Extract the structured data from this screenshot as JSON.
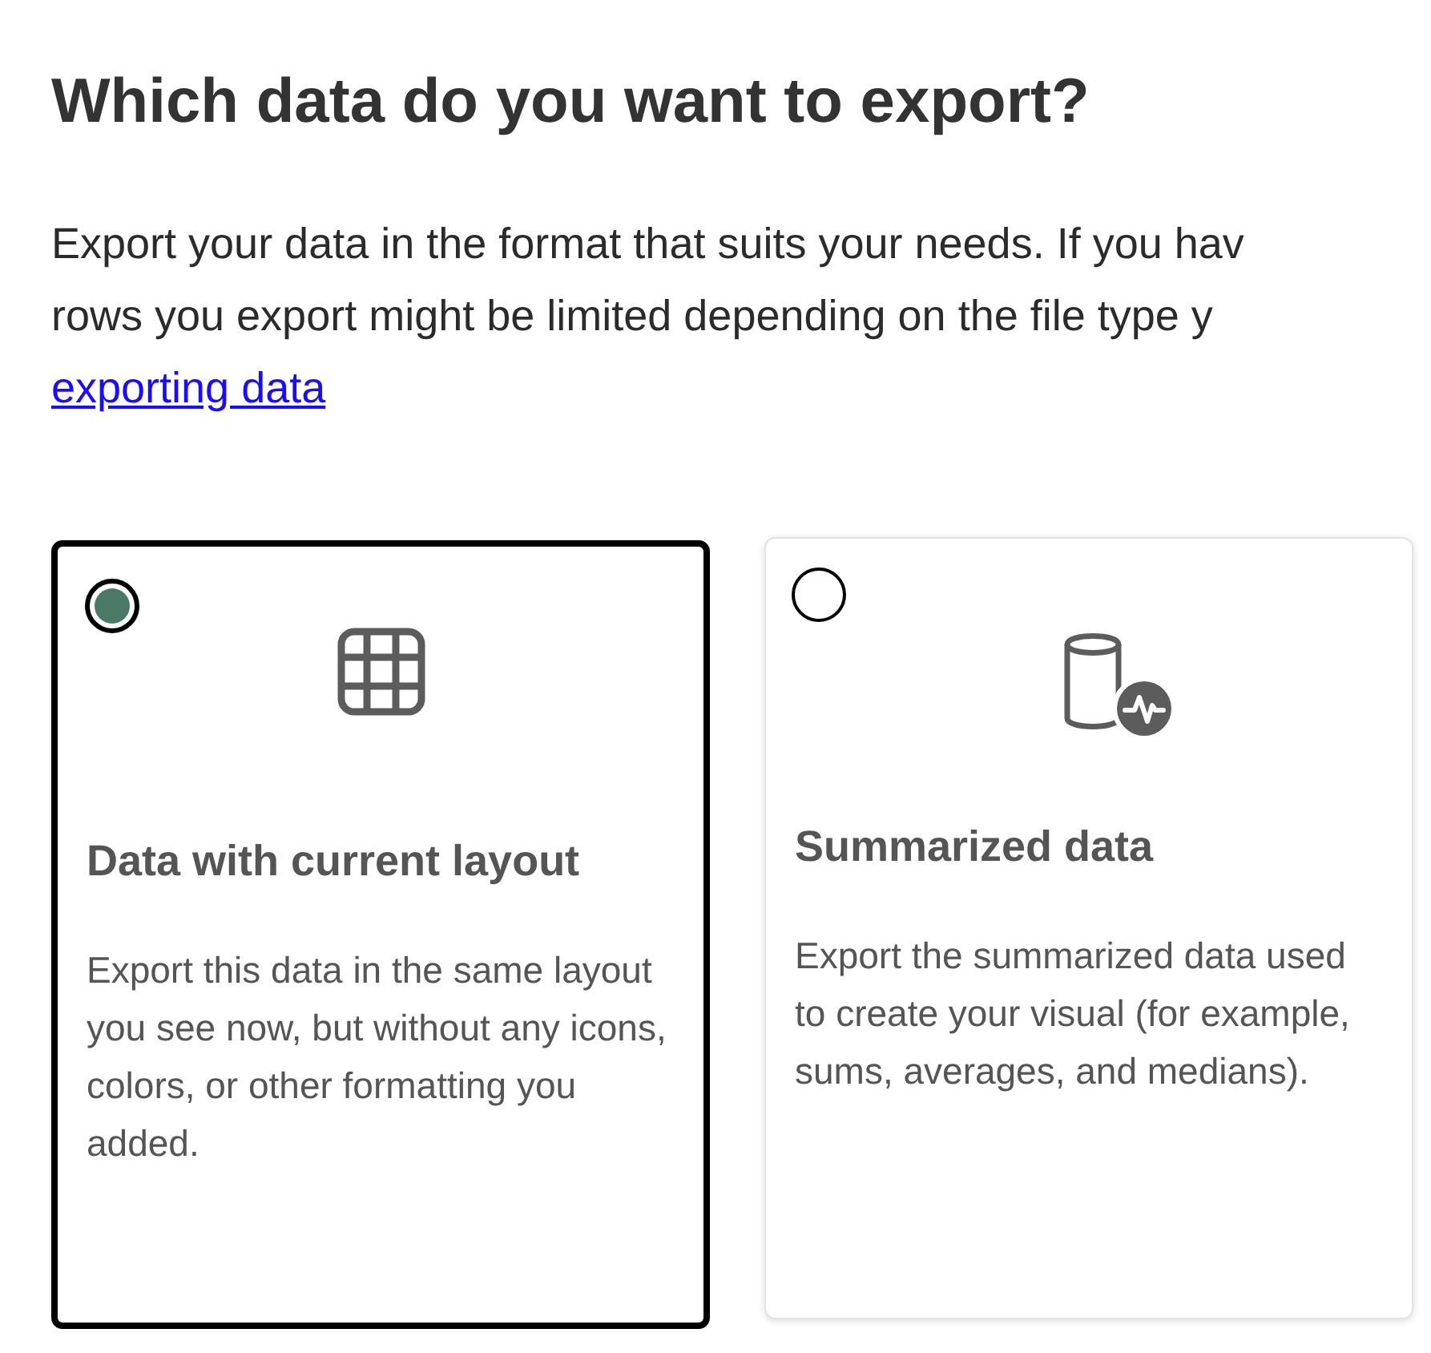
{
  "heading": "Which data do you want to export?",
  "description": {
    "lines": [
      "Export your data in the format that suits your needs. If you hav",
      "rows you export might be limited depending on the file type y"
    ],
    "link": "exporting data"
  },
  "options": [
    {
      "kind": "table",
      "title": "Data with current layout",
      "text": "Export this data in the same layout you see now, but without any icons, colors, or other formatting you added.",
      "selected": true
    },
    {
      "kind": "database",
      "title": "Summarized data",
      "text": "Export the summarized data used to create your visual (for example, sums, averages, and medians).",
      "selected": false
    }
  ]
}
